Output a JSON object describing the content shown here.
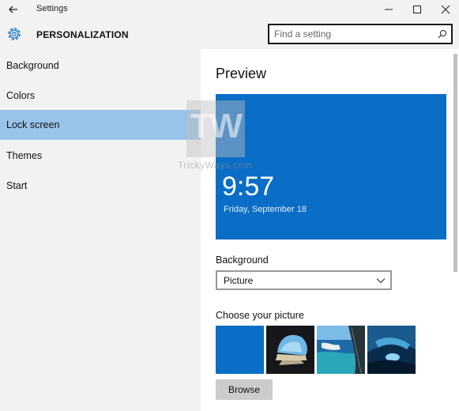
{
  "window": {
    "title": "Settings",
    "controls": {
      "minimize": "minimize-icon",
      "maximize": "maximize-icon",
      "close": "close-icon"
    }
  },
  "header": {
    "title": "PERSONALIZATION",
    "search_placeholder": "Find a setting"
  },
  "sidebar": {
    "items": [
      {
        "label": "Background",
        "active": false
      },
      {
        "label": "Colors",
        "active": false
      },
      {
        "label": "Lock screen",
        "active": true
      },
      {
        "label": "Themes",
        "active": false
      },
      {
        "label": "Start",
        "active": false
      }
    ]
  },
  "main": {
    "preview_title": "Preview",
    "preview": {
      "time": "9:57",
      "date": "Friday, September 18",
      "color": "#0a6dc6"
    },
    "background_label": "Background",
    "background_value": "Picture",
    "choose_label": "Choose your picture",
    "thumbnails": [
      "solid-blue",
      "cave-beach",
      "sea-cliff-window",
      "ice-cave"
    ],
    "browse_label": "Browse"
  },
  "watermark": {
    "logo": "TW",
    "caption": "TrickyWays.com"
  },
  "colors": {
    "accent": "#0a6dc6",
    "selection": "#99c4ea",
    "chrome": "#f2f2f2"
  }
}
